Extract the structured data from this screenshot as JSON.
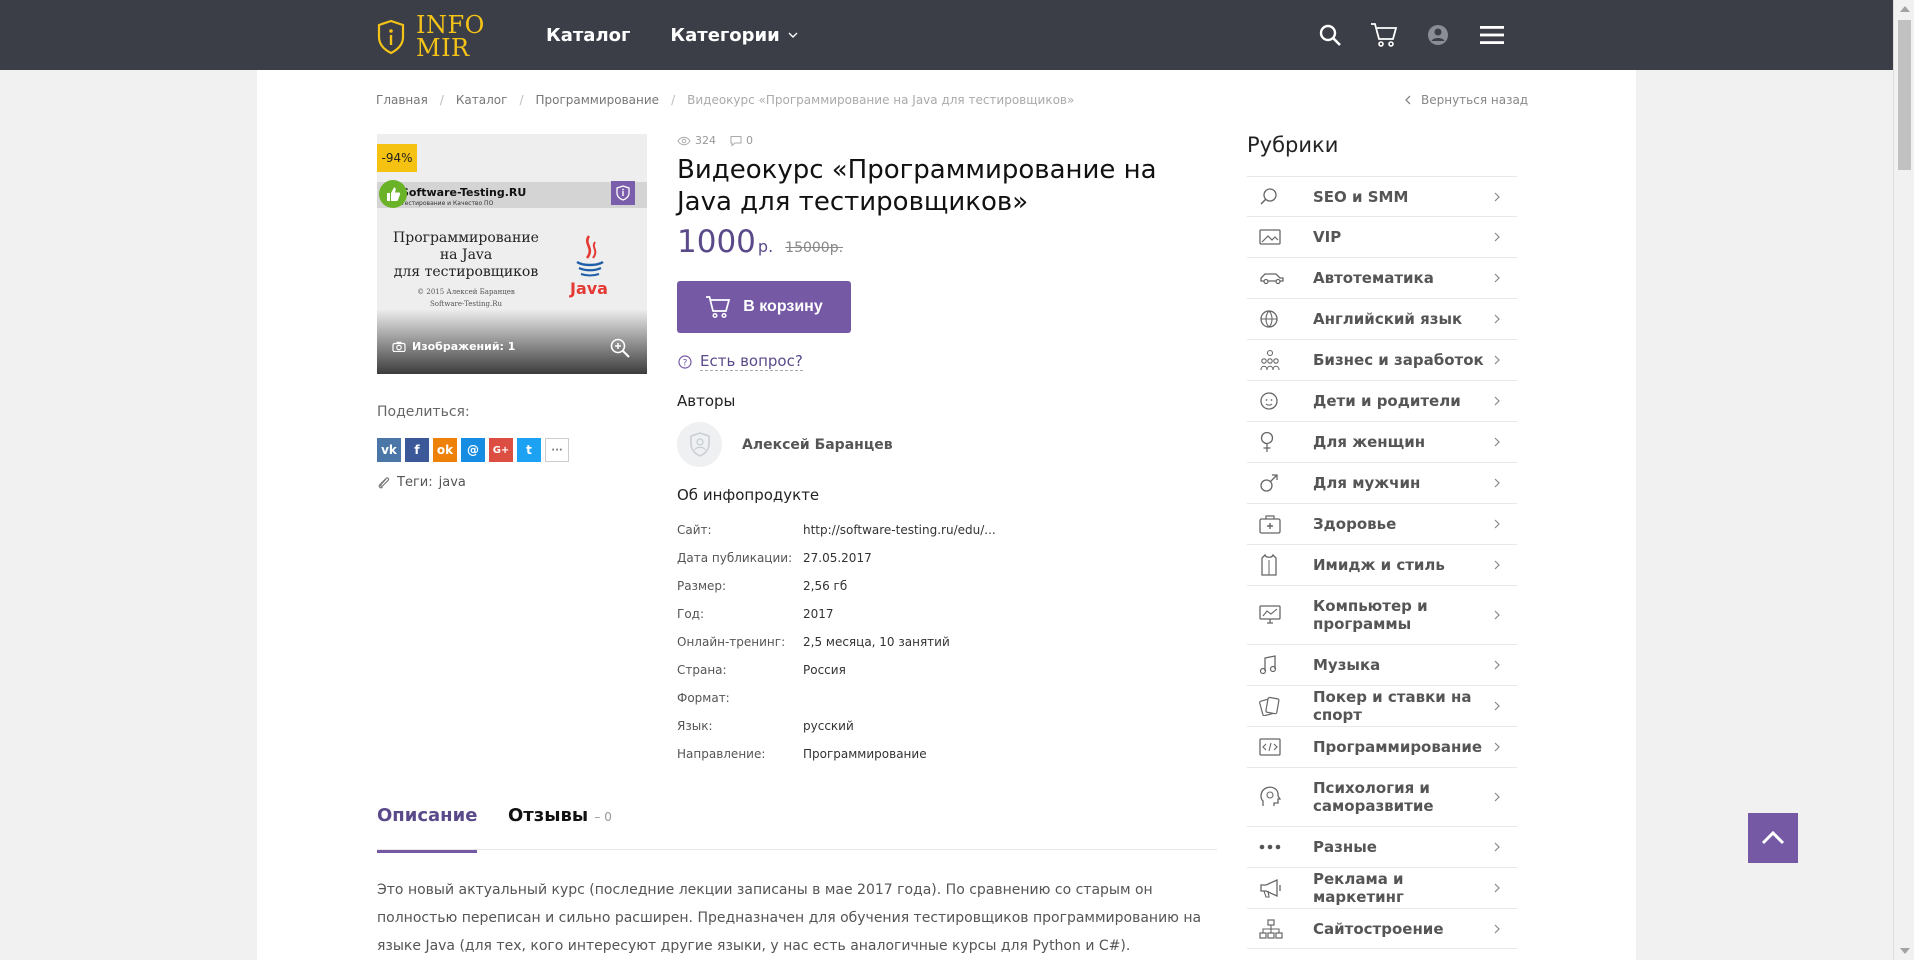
{
  "header": {
    "logo_line1": "INFO",
    "logo_line2": "MIR",
    "nav": {
      "catalog": "Каталог",
      "categories": "Категории"
    },
    "accent_color": "#f3c317"
  },
  "breadcrumb": {
    "items": [
      "Главная",
      "Каталог",
      "Программирование",
      "Видеокурс «Программирование на Java для тестировщиков»"
    ],
    "back": "Вернуться назад"
  },
  "product_image": {
    "discount": "-94%",
    "site": "Software-Testing.RU",
    "site_sub": "Тестирование и Качество ПО",
    "cover_title_1": "Программирование",
    "cover_title_2": "на Java",
    "cover_title_3": "для тестировщиков",
    "cover_copy": "© 2015 Алексей Баранцев",
    "cover_site": "Software-Testing.Ru",
    "java_label": "Java",
    "images_count": "Изображений: 1"
  },
  "share": {
    "label": "Поделиться:",
    "buttons": [
      {
        "icon": "vk-icon",
        "text": "vk",
        "color": "#4a76a8"
      },
      {
        "icon": "facebook-icon",
        "text": "f",
        "color": "#3b5998"
      },
      {
        "icon": "odnoklassniki-icon",
        "text": "ok",
        "color": "#ee8208"
      },
      {
        "icon": "moimir-icon",
        "text": "@",
        "color": "#168de2"
      },
      {
        "icon": "googleplus-icon",
        "text": "G+",
        "color": "#dc4e41"
      },
      {
        "icon": "twitter-icon",
        "text": "t",
        "color": "#1da1f2"
      },
      {
        "icon": "more-icon",
        "text": "···",
        "color": "#ffffff"
      }
    ]
  },
  "tags": {
    "label": "Теги:",
    "value": "java"
  },
  "stats": {
    "views": "324",
    "comments": "0"
  },
  "product": {
    "title": "Видеокурс «Программирование на Java для тестировщиков»",
    "price": "1000",
    "currency": "р.",
    "old_price": "15000р.",
    "cart_button": "В корзину",
    "question": "Есть вопрос?",
    "authors_heading": "Авторы",
    "author_name": "Алексей Баранцев",
    "about_heading": "Об инфопродукте",
    "properties": [
      {
        "key": "Сайт:",
        "value": "http://software-testing.ru/edu/..."
      },
      {
        "key": "Дата публикации:",
        "value": "27.05.2017"
      },
      {
        "key": "Размер:",
        "value": "2,56 гб"
      },
      {
        "key": "Год:",
        "value": "2017"
      },
      {
        "key": "Онлайн-тренинг:",
        "value": "2,5 месяца, 10 занятий"
      },
      {
        "key": "Страна:",
        "value": "Россия"
      },
      {
        "key": "Формат:",
        "value": ""
      },
      {
        "key": "Язык:",
        "value": "русский"
      },
      {
        "key": "Направление:",
        "value": "Программирование"
      }
    ]
  },
  "tabs": {
    "description": "Описание",
    "reviews": "Отзывы",
    "reviews_count": "– 0"
  },
  "description_text": "Это новый актуальный курс (последние лекции записаны в мае 2017 года). По сравнению со старым он полностью переписан и сильно расширен. Предназначен для обучения тестировщиков программированию на языке Java (для тех, кого интересуют другие языки, у нас есть аналогичные курсы для Python и C#).",
  "sidebar": {
    "heading": "Рубрики",
    "items": [
      {
        "label": "SEO и SMM",
        "icon": "search-icon"
      },
      {
        "label": "VIP",
        "icon": "image-icon"
      },
      {
        "label": "Автотематика",
        "icon": "car-icon"
      },
      {
        "label": "Английский язык",
        "icon": "globe-icon"
      },
      {
        "label": "Бизнес и заработок",
        "icon": "people-icon"
      },
      {
        "label": "Дети и родители",
        "icon": "baby-icon"
      },
      {
        "label": "Для женщин",
        "icon": "female-icon"
      },
      {
        "label": "Для мужчин",
        "icon": "male-icon"
      },
      {
        "label": "Здоровье",
        "icon": "medkit-icon"
      },
      {
        "label": "Имидж и стиль",
        "icon": "shirt-icon"
      },
      {
        "label": "Компьютер и программы",
        "icon": "monitor-icon"
      },
      {
        "label": "Музыка",
        "icon": "music-icon"
      },
      {
        "label": "Покер и ставки на спорт",
        "icon": "cards-icon"
      },
      {
        "label": "Программирование",
        "icon": "code-icon"
      },
      {
        "label": "Психология и саморазвитие",
        "icon": "brain-icon"
      },
      {
        "label": "Разные",
        "icon": "dots-icon"
      },
      {
        "label": "Реклама и маркетинг",
        "icon": "megaphone-icon"
      },
      {
        "label": "Сайтостроение",
        "icon": "sitemap-icon"
      }
    ]
  },
  "colors": {
    "header_bg": "#3b3e47",
    "brand_purple": "#7559a5",
    "price_purple": "#5b4a8a",
    "discount_yellow": "#f5c211"
  }
}
